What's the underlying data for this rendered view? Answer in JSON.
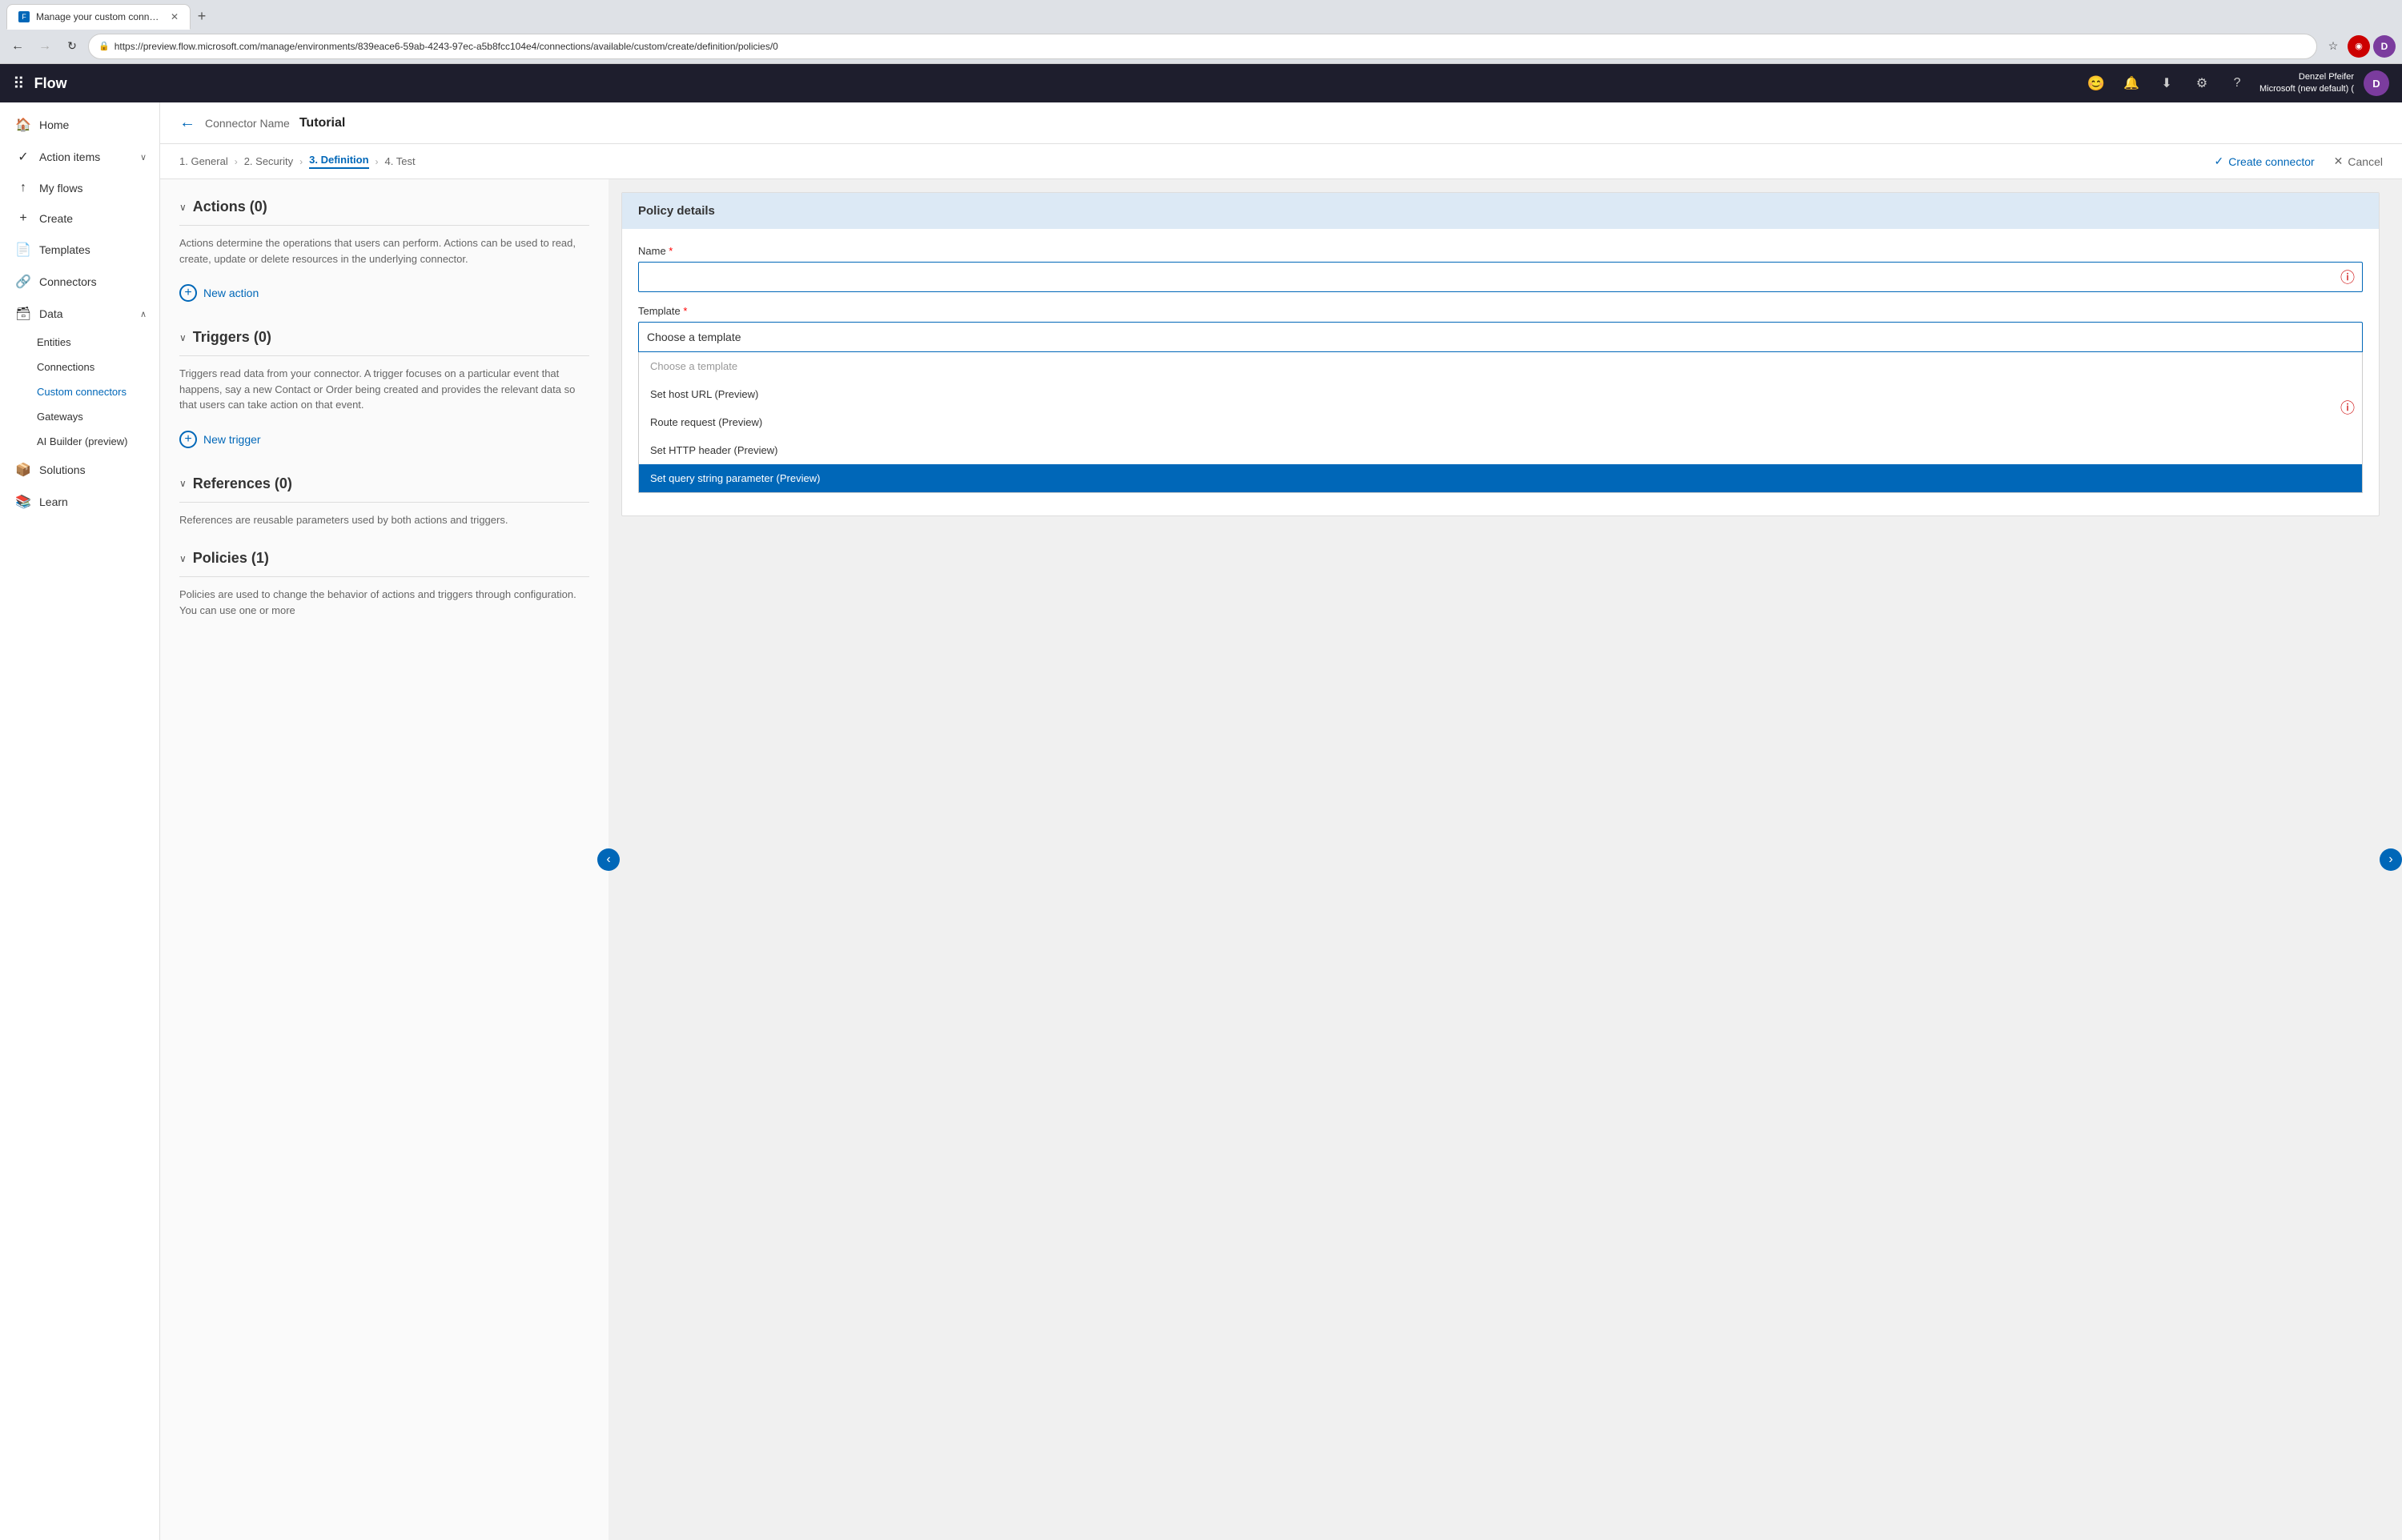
{
  "browser": {
    "tab_title": "Manage your custom connectors",
    "url": "https://preview.flow.microsoft.com/manage/environments/839eace6-59ab-4243-97ec-a5b8fcc104e4/connections/available/custom/create/definition/policies/0",
    "new_tab_icon": "+",
    "back_disabled": false,
    "forward_disabled": false
  },
  "topbar": {
    "app_name": "Flow",
    "icons": [
      "😊",
      "🔔",
      "⬇",
      "⚙",
      "?"
    ],
    "user_name": "Denzel Pfeifer",
    "user_org": "Microsoft (new default) (",
    "avatar_initials": "D"
  },
  "sidebar": {
    "items": [
      {
        "id": "home",
        "icon": "🏠",
        "label": "Home",
        "active": false
      },
      {
        "id": "action-items",
        "icon": "✓",
        "label": "Action items",
        "active": false,
        "expandable": true
      },
      {
        "id": "my-flows",
        "icon": "↑",
        "label": "My flows",
        "active": false
      },
      {
        "id": "create",
        "icon": "+",
        "label": "Create",
        "active": false
      },
      {
        "id": "templates",
        "icon": "📄",
        "label": "Templates",
        "active": false
      },
      {
        "id": "connectors",
        "icon": "🔗",
        "label": "Connectors",
        "active": false
      },
      {
        "id": "data",
        "icon": "🗃",
        "label": "Data",
        "active": false,
        "expandable": true
      },
      {
        "id": "solutions",
        "icon": "📦",
        "label": "Solutions",
        "active": false
      },
      {
        "id": "learn",
        "icon": "📚",
        "label": "Learn",
        "active": false
      }
    ],
    "data_subitems": [
      {
        "id": "entities",
        "label": "Entities",
        "active": false
      },
      {
        "id": "connections",
        "label": "Connections",
        "active": false
      },
      {
        "id": "custom-connectors",
        "label": "Custom connectors",
        "active": true
      },
      {
        "id": "gateways",
        "label": "Gateways",
        "active": false
      },
      {
        "id": "ai-builder",
        "label": "AI Builder (preview)",
        "active": false
      }
    ]
  },
  "connector": {
    "back_label": "←",
    "breadcrumb": "Connector Name",
    "title": "Tutorial"
  },
  "wizard": {
    "steps": [
      {
        "id": "general",
        "label": "1. General",
        "active": false
      },
      {
        "id": "security",
        "label": "2. Security",
        "active": false
      },
      {
        "id": "definition",
        "label": "3. Definition",
        "active": true
      },
      {
        "id": "test",
        "label": "4. Test",
        "active": false
      }
    ],
    "create_label": "Create connector",
    "cancel_label": "Cancel"
  },
  "left_panel": {
    "sections": [
      {
        "id": "actions",
        "title": "Actions (0)",
        "desc": "Actions determine the operations that users can perform. Actions can be used to read, create, update or delete resources in the underlying connector.",
        "new_btn": "New action"
      },
      {
        "id": "triggers",
        "title": "Triggers (0)",
        "desc": "Triggers read data from your connector. A trigger focuses on a particular event that happens, say a new Contact or Order being created and provides the relevant data so that users can take action on that event.",
        "new_btn": "New trigger"
      },
      {
        "id": "references",
        "title": "References (0)",
        "desc": "References are reusable parameters used by both actions and triggers.",
        "new_btn": null
      },
      {
        "id": "policies",
        "title": "Policies (1)",
        "desc": "Policies are used to change the behavior of actions and triggers through configuration. You can use one or more",
        "new_btn": null
      }
    ]
  },
  "policy_details": {
    "header": "Policy details",
    "name_label": "Name",
    "name_required": true,
    "name_value": "",
    "template_label": "Template",
    "template_required": true,
    "template_placeholder": "Choose a template",
    "template_options": [
      {
        "id": "placeholder",
        "label": "Choose a template",
        "type": "placeholder"
      },
      {
        "id": "host-url",
        "label": "Set host URL (Preview)",
        "type": "option"
      },
      {
        "id": "route-request",
        "label": "Route request (Preview)",
        "type": "option"
      },
      {
        "id": "http-header",
        "label": "Set HTTP header (Preview)",
        "type": "option"
      },
      {
        "id": "query-string",
        "label": "Set query string parameter (Preview)",
        "type": "selected"
      }
    ]
  }
}
